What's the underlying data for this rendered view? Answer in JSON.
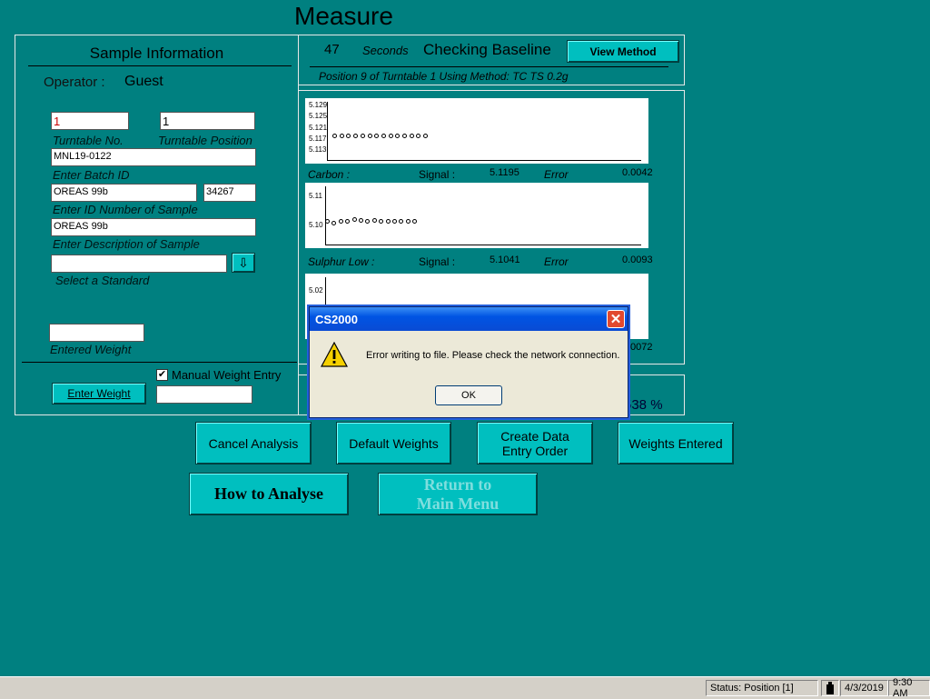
{
  "title": "Measure",
  "sample": {
    "heading": "Sample Information",
    "operator_label": "Operator :",
    "operator_value": "Guest",
    "turntable_no": "1",
    "turntable_pos": "1",
    "turntable_no_label": "Turntable No.",
    "turntable_pos_label": "Turntable Position",
    "batch_id": "MNL19-0122",
    "batch_label": "Enter Batch ID",
    "sample_id": "OREAS 99b",
    "sample_num": "34267",
    "id_label": "Enter ID Number of Sample",
    "description": "OREAS 99b",
    "desc_label": "Enter Description of Sample",
    "standard": "",
    "standard_label": "Select a Standard",
    "weight": "",
    "weight_label": "Entered Weight",
    "manual_label": "Manual Weight Entry",
    "manual_checked": true,
    "enter_weight": "Enter Weight",
    "manual_value": ""
  },
  "status": {
    "seconds": "47",
    "seconds_label": "Seconds",
    "state": "Checking Baseline",
    "view_method": "View Method",
    "position_text": "Position 9 of Turntable 1 Using Method: TC TS 0.2g"
  },
  "charts": {
    "carbon": {
      "yticks": [
        "5.129",
        "5.125",
        "5.121",
        "5.117",
        "5.113"
      ],
      "name": "Carbon :",
      "signal_label": "Signal :",
      "signal": "5.1195",
      "error_label": "Error",
      "error": "0.0042"
    },
    "sulphur": {
      "yticks": [
        "5.11",
        "5.10"
      ],
      "name": "Sulphur Low :",
      "signal_label": "Signal :",
      "signal": "5.1041",
      "error_label": "Error",
      "error": "0.0093"
    },
    "third": {
      "yticks": [
        "5.02"
      ],
      "error": "0072"
    }
  },
  "chart_data": [
    {
      "type": "scatter",
      "x": [
        1,
        2,
        3,
        4,
        5,
        6,
        7,
        8,
        9,
        10,
        11,
        12,
        13,
        14
      ],
      "y": [
        5.1195,
        5.1195,
        5.1195,
        5.1195,
        5.1195,
        5.1195,
        5.1195,
        5.1195,
        5.1195,
        5.1195,
        5.1195,
        5.1195,
        5.1195,
        5.1195
      ],
      "ylim": [
        5.111,
        5.131
      ],
      "title": ""
    },
    {
      "type": "scatter",
      "x": [
        1,
        2,
        3,
        4,
        5,
        6,
        7,
        8,
        9,
        10,
        11,
        12,
        13,
        14
      ],
      "y": [
        5.1041,
        5.1035,
        5.1041,
        5.1041,
        5.1047,
        5.1044,
        5.1041,
        5.1044,
        5.1041,
        5.1041,
        5.1041,
        5.1041,
        5.1041,
        5.1041
      ],
      "ylim": [
        5.096,
        5.116
      ],
      "title": ""
    }
  ],
  "percent": "538 %",
  "buttons": {
    "cancel": "Cancel Analysis",
    "default": "Default Weights",
    "create": "Create Data Entry Order",
    "entered": "Weights Entered",
    "how": "How to Analyse",
    "return": "Return to Main Menu"
  },
  "dialog": {
    "title": "CS2000",
    "message": "Error writing to file.  Please check the network connection.",
    "ok": "OK"
  },
  "statusbar": {
    "status": "Status: Position [1]",
    "date": "4/3/2019",
    "time": "9:30 AM"
  }
}
